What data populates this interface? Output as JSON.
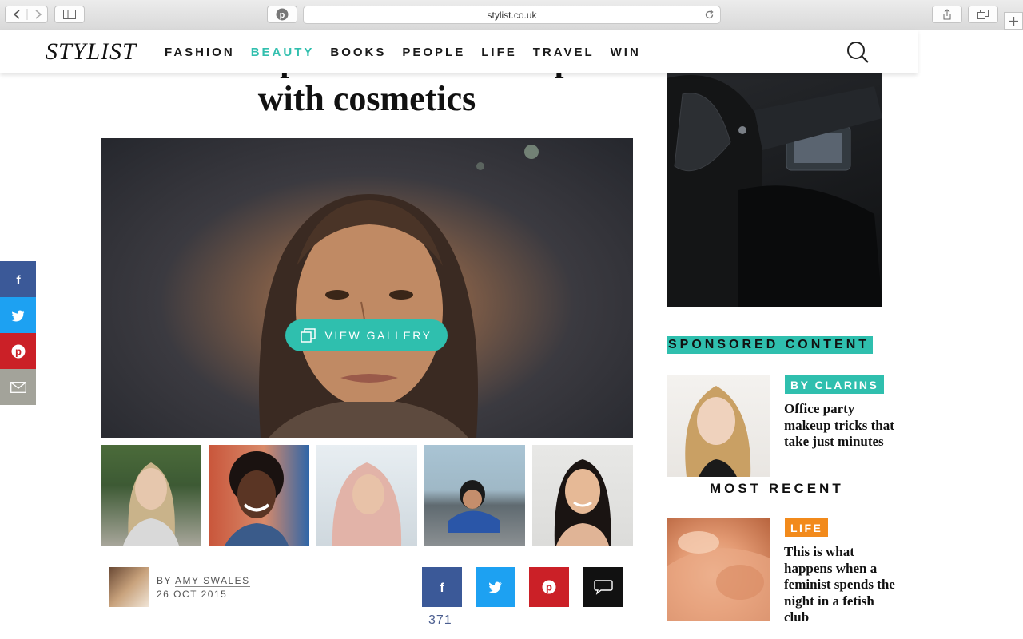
{
  "browser": {
    "url": "stylist.co.uk"
  },
  "header": {
    "logo": "STYLIST",
    "nav": [
      "FASHION",
      "BEAUTY",
      "BOOKS",
      "PEOPLE",
      "LIFE",
      "TRAVEL",
      "WIN"
    ],
    "active_nav": "BEAUTY"
  },
  "article": {
    "ghost_headline": "our complicated relationship",
    "headline_line": "with cosmetics",
    "view_gallery_label": "VIEW GALLERY",
    "byline_prefix": "BY",
    "author": "AMY SWALES",
    "date": "26 OCT 2015",
    "share_count": "371"
  },
  "sidebar": {
    "sponsored_title": "SPONSORED CONTENT",
    "sponsored_card": {
      "tag": "BY CLARINS",
      "title": "Office party makeup tricks that take just minutes"
    },
    "most_recent_title": "MOST RECENT",
    "recent_card": {
      "tag": "LIFE",
      "title": "This is what happens when a feminist spends the night in a fetish club"
    }
  },
  "colors": {
    "accent": "#2fbfae",
    "facebook": "#3b5998",
    "twitter": "#1da1f2",
    "pinterest": "#cb2027",
    "email": "#a3a39a",
    "comment": "#111111",
    "life_tag": "#f28a1b"
  }
}
